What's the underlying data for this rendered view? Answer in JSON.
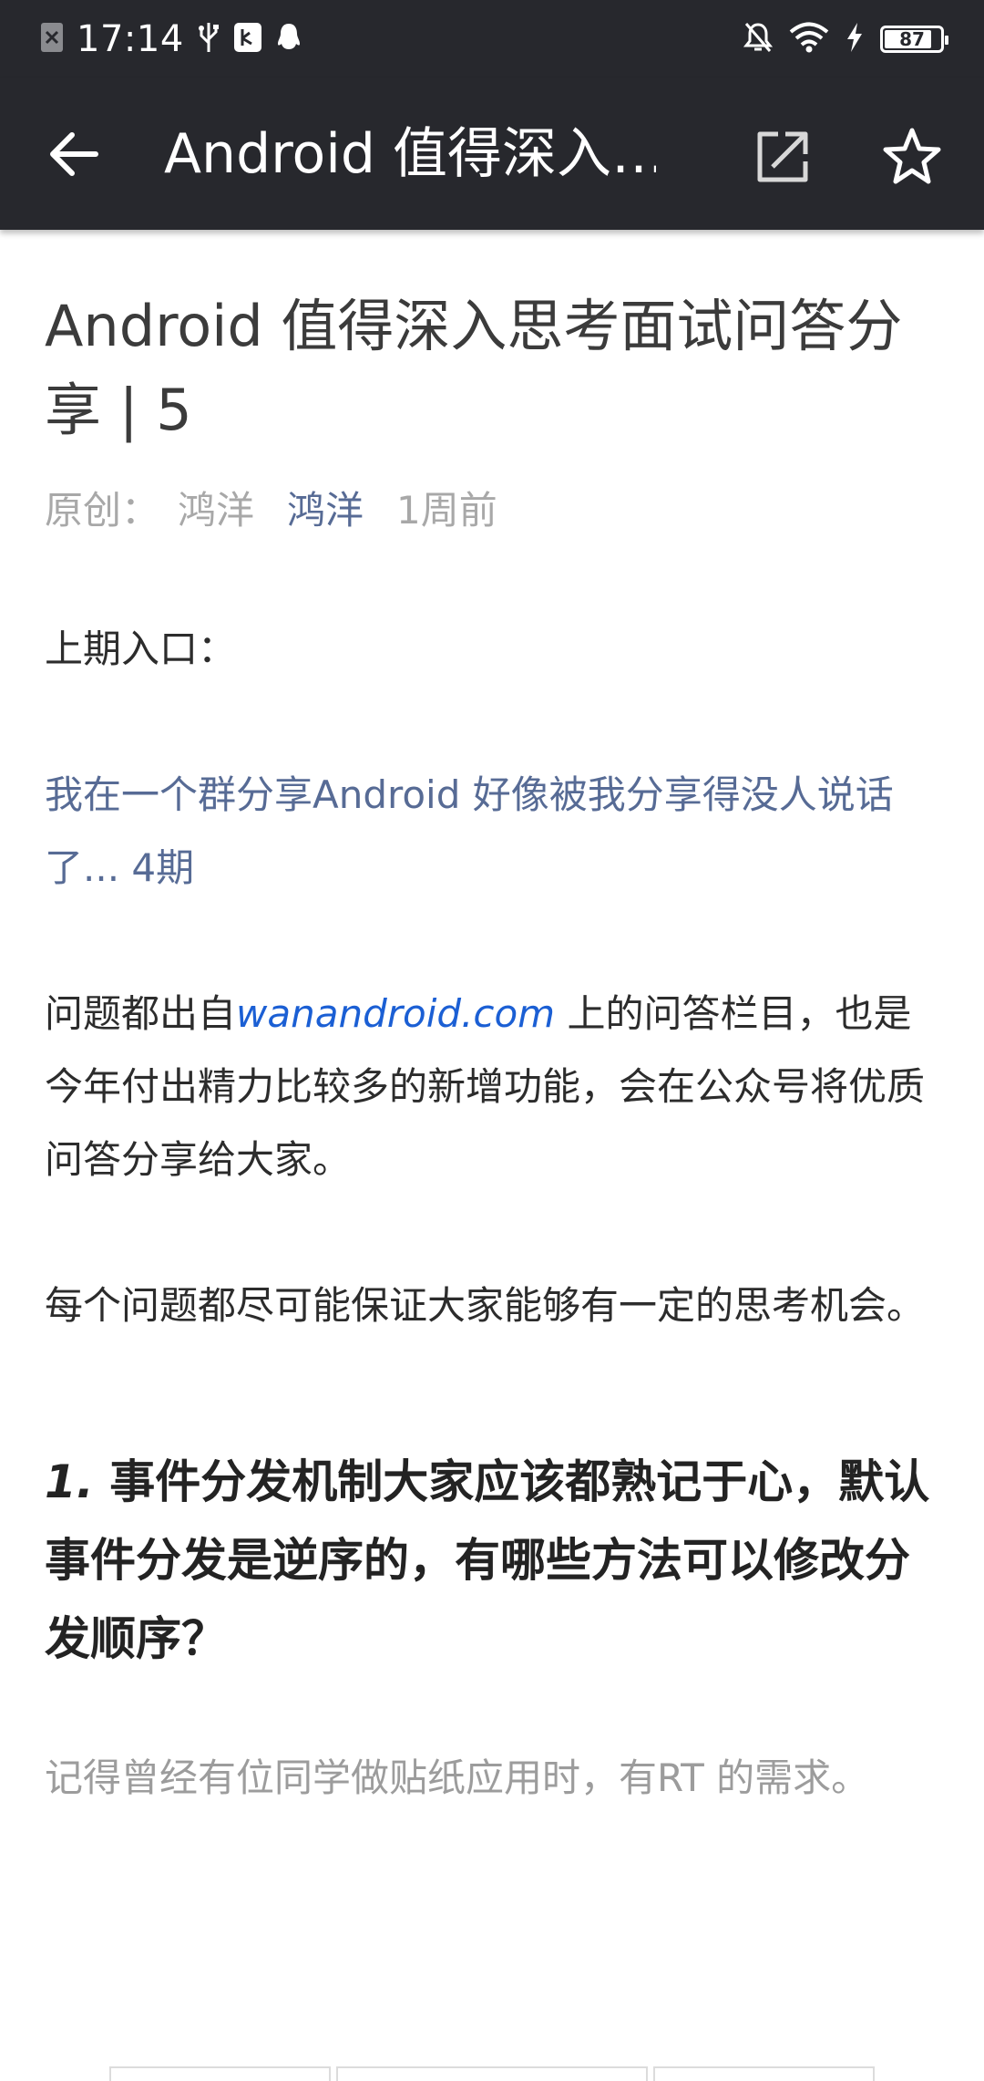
{
  "status_bar": {
    "time": "17:14",
    "battery_level": "87",
    "icons": [
      "sim-x-icon",
      "usb-icon",
      "usb-debug-icon",
      "qq-notification-icon",
      "mute-icon",
      "wifi-icon",
      "charging-icon",
      "battery-icon"
    ]
  },
  "toolbar": {
    "title": "Android 值得深入…",
    "back_icon": "arrow-back-icon",
    "share_icon": "share-icon",
    "star_icon": "star-outline-icon"
  },
  "article": {
    "title": "Android 值得深入思考面试问答分享 | 5",
    "meta": {
      "original_label": "原创：",
      "author": "鸿洋",
      "account_link": "鸿洋",
      "time": "1周前"
    },
    "p1": "上期入口：",
    "link_text": "我在一个群分享Android 好像被我分享得没人说话了... 4期",
    "p3_before": "问题都出自",
    "p3_site": "wanandroid.com",
    "p3_after": " 上的问答栏目，也是今年付出精力比较多的新增功能，会在公众号将优质问答分享给大家。",
    "p4": "每个问题都尽可能保证大家能够有一定的思考机会。",
    "q1_number": "1.",
    "q1_text": " 事件分发机制大家应该都熟记于心，默认事件分发是逆序的，有哪些方法可以修改分发顺序？",
    "p5": "记得曾经有位同学做贴纸应用时，有RT 的需求。"
  },
  "colors": {
    "toolbar_bg": "#27282d",
    "link_blue": "#576b95",
    "site_blue": "#1b5fd4",
    "meta_gray": "#a8a8a8",
    "gray_text": "#9c9c9c"
  }
}
